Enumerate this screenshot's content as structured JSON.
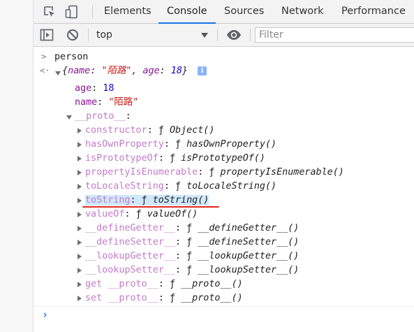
{
  "tabs": [
    {
      "label": "Elements",
      "active": false
    },
    {
      "label": "Console",
      "active": true
    },
    {
      "label": "Sources",
      "active": false
    },
    {
      "label": "Network",
      "active": false
    },
    {
      "label": "Performance",
      "active": false
    }
  ],
  "icons": {
    "inspect": "inspect-element-icon",
    "device": "device-toolbar-icon",
    "sidebar": "console-sidebar-icon",
    "clear": "clear-console-icon",
    "eye": "live-expression-eye-icon"
  },
  "toolbar": {
    "context": "top",
    "filter_placeholder": "Filter"
  },
  "console": {
    "input": "person",
    "summary": {
      "open": "{",
      "k1": "name",
      "colon1": ": ",
      "v1": "\"陌路\"",
      "comma": ", ",
      "k2": "age",
      "colon2": ": ",
      "v2": "18",
      "close": "}",
      "info": "i"
    },
    "props": [
      {
        "key": "age",
        "colon": ": ",
        "value": "18"
      },
      {
        "key": "name",
        "colon": ": ",
        "value": "\"陌路\""
      }
    ],
    "proto": {
      "key": "__proto__",
      "colon": ":"
    },
    "proto_items": [
      {
        "key": "constructor",
        "colon": ": ",
        "f": "ƒ ",
        "fn": "Object()"
      },
      {
        "key": "hasOwnProperty",
        "colon": ": ",
        "f": "ƒ ",
        "fn": "hasOwnProperty()"
      },
      {
        "key": "isPrototypeOf",
        "colon": ": ",
        "f": "ƒ ",
        "fn": "isPrototypeOf()"
      },
      {
        "key": "propertyIsEnumerable",
        "colon": ": ",
        "f": "ƒ ",
        "fn": "propertyIsEnumerable()"
      },
      {
        "key": "toLocaleString",
        "colon": ": ",
        "f": "ƒ ",
        "fn": "toLocaleString()"
      },
      {
        "key": "toString",
        "colon": ": ",
        "f": "ƒ ",
        "fn": "toString()"
      },
      {
        "key": "valueOf",
        "colon": ": ",
        "f": "ƒ ",
        "fn": "valueOf()"
      },
      {
        "key": "__defineGetter__",
        "colon": ": ",
        "f": "ƒ ",
        "fn": "__defineGetter__()"
      },
      {
        "key": "__defineSetter__",
        "colon": ": ",
        "f": "ƒ ",
        "fn": "__defineSetter__()"
      },
      {
        "key": "__lookupGetter__",
        "colon": ": ",
        "f": "ƒ ",
        "fn": "__lookupGetter__()"
      },
      {
        "key": "__lookupSetter__",
        "colon": ": ",
        "f": "ƒ ",
        "fn": "__lookupSetter__()"
      },
      {
        "key": "get __proto__",
        "colon": ": ",
        "f": "ƒ ",
        "fn": "__proto__()"
      },
      {
        "key": "set __proto__",
        "colon": ": ",
        "f": "ƒ ",
        "fn": "__proto__()"
      }
    ],
    "prompt": "›"
  },
  "colors": {
    "active_tab_underline": "#1a73e8",
    "key": "#881391",
    "faded_key": "#c27bc8",
    "number": "#1c00cf",
    "string": "#c41a16",
    "highlight": "#cfe8fc",
    "annotation_underline": "#e0281e"
  }
}
